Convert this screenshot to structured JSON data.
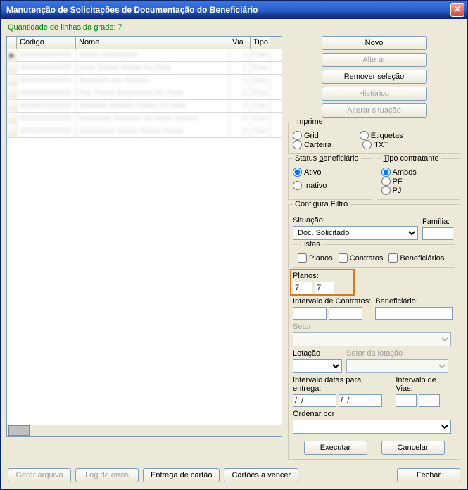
{
  "window_title": "Manutenção de Solicitações de Documentação do Beneficiário",
  "lines_label": "Quantidade de linhas da grade: 7",
  "grid": {
    "cols": {
      "codigo": "Código",
      "nome": "Nome",
      "via": "Via",
      "tipo": "Tipo"
    },
    "rows": [
      {
        "codigo": "XXXXXXXXXX",
        "nome": "Xxxxx Xxxxxxxxx",
        "via": "1",
        "tipo": "Cxx"
      },
      {
        "codigo": "XXXXXXXXXX",
        "nome": "Xxxx Xxxxx Xxxxx Xx Xxxx",
        "via": "1",
        "tipo": "Cxx"
      },
      {
        "codigo": "XXXXXXXXXX",
        "nome": "XxxxxxX xxx Xxxxxx",
        "via": "1",
        "tipo": "Cxx"
      },
      {
        "codigo": "XXXXXXXXXX",
        "nome": "Xxx Xxxxx Xxxxxxxxx Xx Xxxx",
        "via": "2",
        "tipo": "Cxx"
      },
      {
        "codigo": "XXXXXXXXXX",
        "nome": "Xxxxxxx Xxxxxx Xxxxx Xx Xxxx",
        "via": "2",
        "tipo": "Cxx"
      },
      {
        "codigo": "XXXXXXXXXX",
        "nome": "Xxxxxxxx Xxxxxxx Xx Xxxx Xxxxxx",
        "via": "2",
        "tipo": "Cxx"
      },
      {
        "codigo": "XXXXXXXXXX",
        "nome": "Xxxxxxxxx Xxxxx Xxxxx Xxxxx",
        "via": "2",
        "tipo": "Cxx"
      }
    ]
  },
  "buttons": {
    "novo": "Novo",
    "novo_u": "N",
    "alterar": "Alterar",
    "remover": "Remover seleção",
    "remover_u": "R",
    "historico": "Histórico",
    "altsit": "Alterar situação",
    "executar": "Executar",
    "executar_u": "E",
    "cancelar": "Cancelar",
    "gerar": "Gerar arquivo",
    "log": "Log de erros",
    "entrega": "Entrega de cartão",
    "vencer": "Cartões a vencer",
    "fechar": "Fechar"
  },
  "imprime": {
    "title": "Imprime",
    "title_u": "I",
    "grid": "Grid",
    "carteira": "Carteira",
    "etiquetas": "Etiquetas",
    "txt": "TXT"
  },
  "status": {
    "title": "Status beneficiário",
    "title_u": "b",
    "ativo": "Ativo",
    "inativo": "Inativo"
  },
  "tipoc": {
    "title": "Tipo contratante",
    "title_u": "T",
    "ambos": "Ambos",
    "pf": "PF",
    "pj": "PJ"
  },
  "filtro": {
    "title": "Configura Filtro",
    "situacao": "Situação:",
    "situacao_val": "Doc. Solicitado",
    "familia": "Família:",
    "listas": "Listas",
    "planos_chk": "Planos",
    "contratos_chk": "Contratos",
    "benef_chk": "Beneficiários",
    "planos_lbl": "Planos:",
    "planos_from": "7",
    "planos_to": "7",
    "contratos_lbl": "Intervalo de Contratos:",
    "benef_lbl": "Beneficiário:",
    "setor": "Setor",
    "lotacao": "Lotação",
    "setorlot": "Setor da lotação",
    "datas_lbl": "Intervalo datas para entrega:",
    "vias_lbl": "Intervalo de Vias:",
    "date_ph": "/  /",
    "ordenar": "Ordenar por"
  }
}
